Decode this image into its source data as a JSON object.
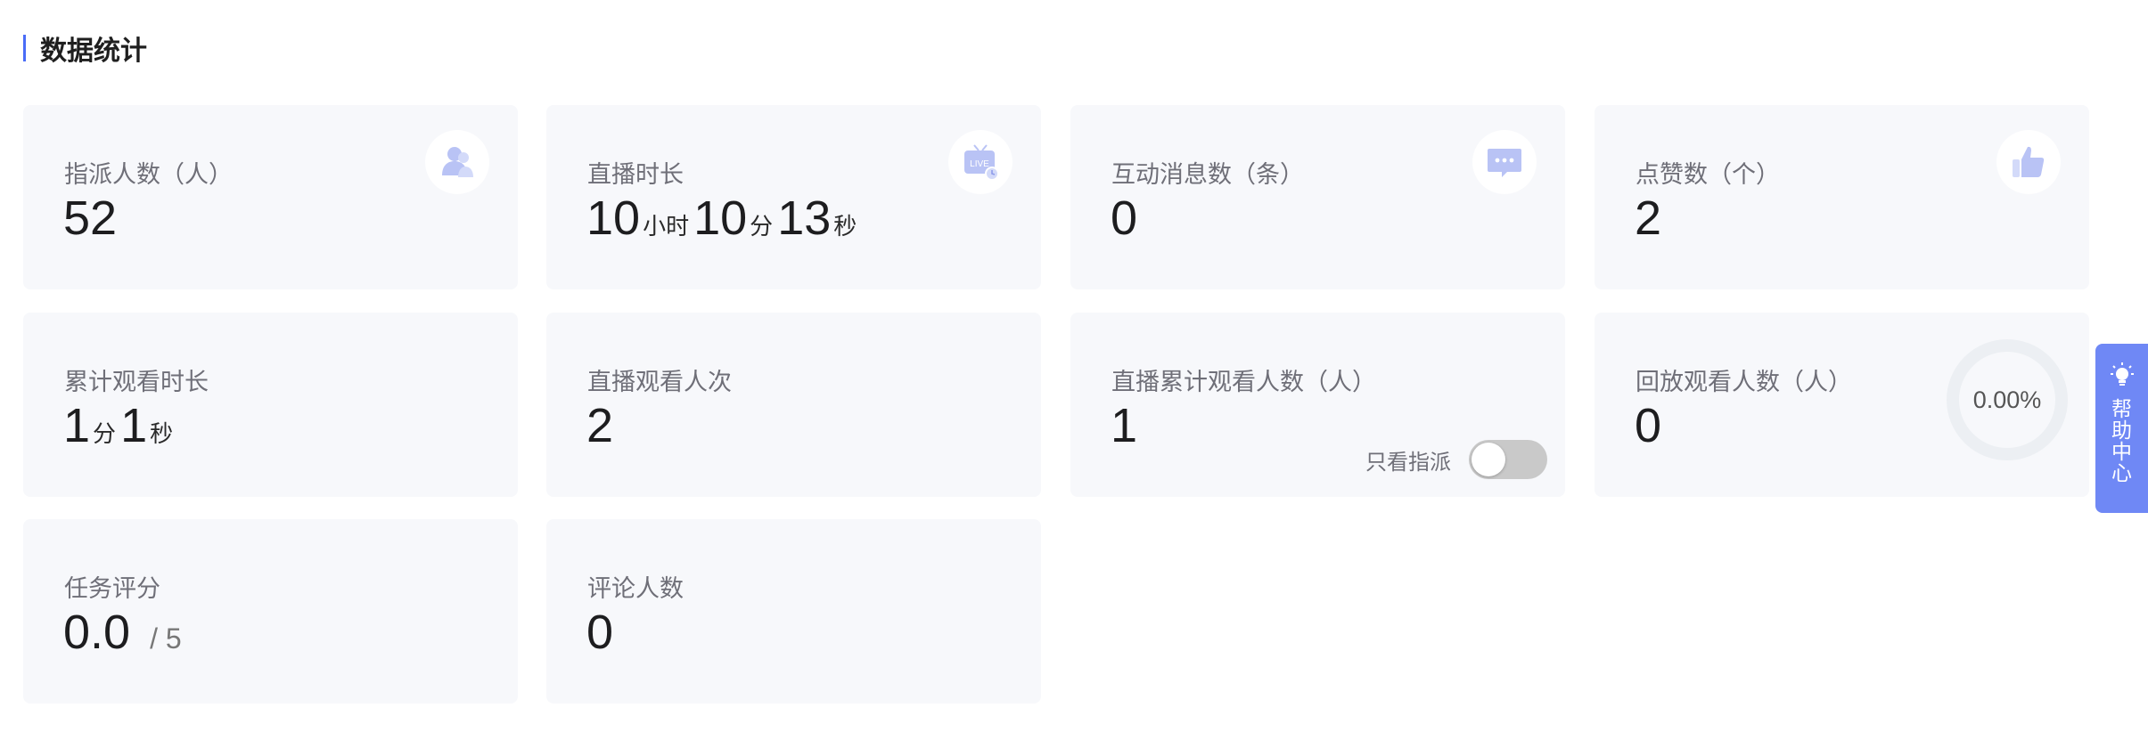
{
  "section": {
    "title": "数据统计"
  },
  "cards": {
    "assigned": {
      "label": "指派人数（人）",
      "value": "52",
      "icon": "users-icon"
    },
    "live_duration": {
      "label": "直播时长",
      "hours": "10",
      "hours_unit": "小时",
      "minutes": "10",
      "minutes_unit": "分",
      "seconds": "13",
      "seconds_unit": "秒",
      "icon": "live-tv-icon"
    },
    "messages": {
      "label": "互动消息数（条）",
      "value": "0",
      "icon": "chat-icon"
    },
    "likes": {
      "label": "点赞数（个）",
      "value": "2",
      "icon": "thumbs-up-icon"
    },
    "watch_time": {
      "label": "累计观看时长",
      "minutes": "1",
      "minutes_unit": "分",
      "seconds": "1",
      "seconds_unit": "秒"
    },
    "live_views": {
      "label": "直播观看人次",
      "value": "2"
    },
    "live_viewers": {
      "label": "直播累计观看人数（人）",
      "value": "1",
      "toggle_label": "只看指派",
      "toggle_on": false
    },
    "replay_viewers": {
      "label": "回放观看人数（人）",
      "value": "0",
      "ring_text": "0.00%",
      "ring_percent": 0
    },
    "task_score": {
      "label": "任务评分",
      "value": "0.0",
      "suffix": "/ 5"
    },
    "commenters": {
      "label": "评论人数",
      "value": "0"
    }
  },
  "help": {
    "text": "帮助中心",
    "icon": "lightbulb-icon"
  },
  "colors": {
    "accent": "#4a6cf7",
    "help_tab": "#6f88f5",
    "card_bg": "#f7f8fb",
    "icon": "#b9c3f5"
  }
}
